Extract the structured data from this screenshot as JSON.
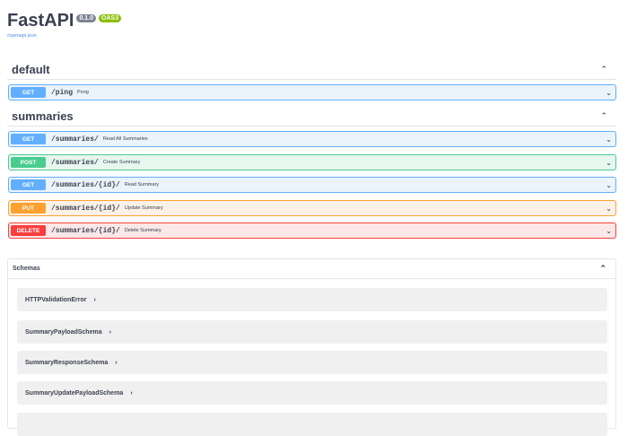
{
  "header": {
    "title": "FastAPI",
    "version": "0.1.0",
    "oas": "OAS3",
    "spec_link": "/openapi.json"
  },
  "colors": {
    "get": "#61affe",
    "post": "#49cc90",
    "put": "#fca130",
    "delete": "#f93e3e"
  },
  "tags": [
    {
      "name": "default",
      "operations": [
        {
          "method": "GET",
          "path": "/ping",
          "summary": "Pong"
        }
      ]
    },
    {
      "name": "summaries",
      "operations": [
        {
          "method": "GET",
          "path": "/summaries/",
          "summary": "Read All Summaries"
        },
        {
          "method": "POST",
          "path": "/summaries/",
          "summary": "Create Summary"
        },
        {
          "method": "GET",
          "path": "/summaries/{id}/",
          "summary": "Read Summary"
        },
        {
          "method": "PUT",
          "path": "/summaries/{id}/",
          "summary": "Update Summary"
        },
        {
          "method": "DELETE",
          "path": "/summaries/{id}/",
          "summary": "Delete Summary"
        }
      ]
    }
  ],
  "schemas": {
    "title": "Schemas",
    "items": [
      "HTTPValidationError",
      "SummaryPayloadSchema",
      "SummaryResponseSchema",
      "SummaryUpdatePayloadSchema"
    ]
  }
}
